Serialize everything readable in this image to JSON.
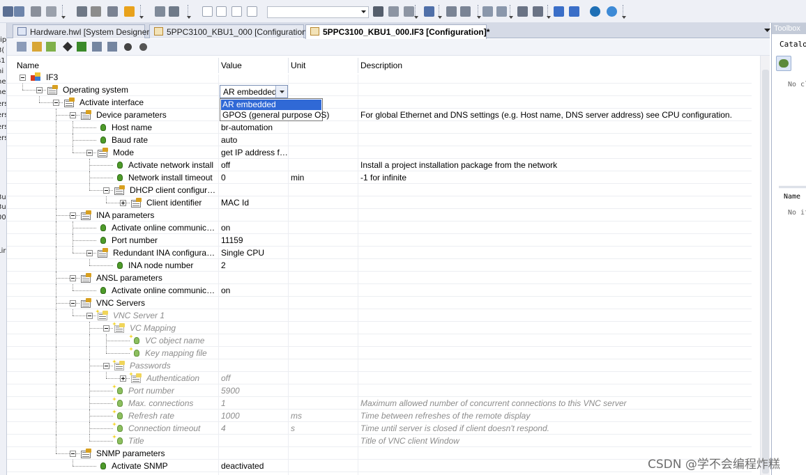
{
  "toolbar": {
    "icons": [
      "properties-icon",
      "grid-icon",
      "cut-icon",
      "paste-icon",
      "search-icon",
      "refresh-icon",
      "power-icon",
      "stop-icon",
      "gear-icon",
      "gear-settings-icon",
      "window-icon",
      "window-new-icon",
      "window-bubble-icon",
      "window-compare-icon",
      "binoculars-icon",
      "binoculars-back-icon",
      "binoculars-forward-icon",
      "save-icon",
      "sort-down-icon",
      "sort-up-icon",
      "arrow-up-icon",
      "arrow-down-icon",
      "list-icon",
      "list-indent-icon",
      "upload-icon",
      "minus-icon",
      "globe-icon",
      "help-icon"
    ],
    "combo_value": ""
  },
  "left_strip": {
    "fragments": [
      "rip",
      "3(",
      "s1",
      "hi",
      "he",
      "he",
      "ers",
      "ers",
      "ers",
      "ers",
      "3u",
      "3u",
      "00",
      "Lir"
    ]
  },
  "tabs": [
    {
      "label": "Hardware.hwl [System Designer]",
      "active": false,
      "icon": "hardware-icon"
    },
    {
      "label": "5PPC3100_KBU1_000 [Configuration]",
      "active": false,
      "icon": "configuration-icon"
    },
    {
      "label": "5PPC3100_KBU1_000.IF3 [Configuration]*",
      "active": true,
      "icon": "configuration-icon"
    }
  ],
  "editor_toolbar": {
    "icons": [
      "properties-icon",
      "grid-edit-icon",
      "bulb-icon",
      "diamond-icon",
      "diamond-pair-icon",
      "sort-down-icon",
      "sort-up-icon",
      "record-icon",
      "settings-icon"
    ]
  },
  "grid": {
    "columns": {
      "name": "Name",
      "value": "Value",
      "unit": "Unit",
      "description": "Description"
    },
    "rows": [
      {
        "name": "IF3",
        "value": "",
        "unit": "",
        "desc": "",
        "level": 0,
        "kind": "root",
        "exp": "minus",
        "dis": false
      },
      {
        "name": "Operating system",
        "value": "",
        "unit": "",
        "desc": "",
        "level": 1,
        "kind": "folder",
        "exp": "minus",
        "dis": false
      },
      {
        "name": "Activate interface",
        "value": "",
        "unit": "",
        "desc": "",
        "level": 2,
        "kind": "folder",
        "exp": "minus",
        "dis": false
      },
      {
        "name": "Device parameters",
        "value": "",
        "unit": "",
        "desc": "For global Ethernet and DNS settings (e.g. Host name, DNS server address) see CPU configuration.",
        "level": 3,
        "kind": "folder",
        "exp": "minus",
        "dis": false
      },
      {
        "name": "Host name",
        "value": "br-automation",
        "unit": "",
        "desc": "",
        "level": 4,
        "kind": "leaf",
        "exp": "",
        "dis": false
      },
      {
        "name": "Baud rate",
        "value": "auto",
        "unit": "",
        "desc": "",
        "level": 4,
        "kind": "leaf",
        "exp": "",
        "dis": false
      },
      {
        "name": "Mode",
        "value": "get IP address fro...",
        "unit": "",
        "desc": "",
        "level": 4,
        "kind": "folder",
        "exp": "minus",
        "dis": false
      },
      {
        "name": "Activate network install",
        "value": "off",
        "unit": "",
        "desc": "Install a project installation package from the network",
        "level": 5,
        "kind": "leaf",
        "exp": "",
        "dis": false
      },
      {
        "name": "Network install timeout",
        "value": "0",
        "unit": "min",
        "desc": "-1 for infinite",
        "level": 5,
        "kind": "leaf",
        "exp": "",
        "dis": false
      },
      {
        "name": "DHCP client configurat...",
        "value": "",
        "unit": "",
        "desc": "",
        "level": 5,
        "kind": "folder",
        "exp": "minus",
        "dis": false
      },
      {
        "name": "Client identifier",
        "value": "MAC Id",
        "unit": "",
        "desc": "",
        "level": 6,
        "kind": "folder",
        "exp": "plus",
        "dis": false
      },
      {
        "name": "INA parameters",
        "value": "",
        "unit": "",
        "desc": "",
        "level": 3,
        "kind": "folder",
        "exp": "minus",
        "dis": false
      },
      {
        "name": "Activate online communicati...",
        "value": "on",
        "unit": "",
        "desc": "",
        "level": 4,
        "kind": "leaf",
        "exp": "",
        "dis": false
      },
      {
        "name": "Port number",
        "value": "11159",
        "unit": "",
        "desc": "",
        "level": 4,
        "kind": "leaf",
        "exp": "",
        "dis": false
      },
      {
        "name": "Redundant INA configuration",
        "value": "Single CPU",
        "unit": "",
        "desc": "",
        "level": 4,
        "kind": "folder",
        "exp": "minus",
        "dis": false
      },
      {
        "name": "INA node number",
        "value": "2",
        "unit": "",
        "desc": "",
        "level": 5,
        "kind": "leaf",
        "exp": "",
        "dis": false
      },
      {
        "name": "ANSL parameters",
        "value": "",
        "unit": "",
        "desc": "",
        "level": 3,
        "kind": "folder",
        "exp": "minus",
        "dis": false
      },
      {
        "name": "Activate online communicati...",
        "value": "on",
        "unit": "",
        "desc": "",
        "level": 4,
        "kind": "leaf",
        "exp": "",
        "dis": false
      },
      {
        "name": "VNC Servers",
        "value": "",
        "unit": "",
        "desc": "",
        "level": 3,
        "kind": "folder",
        "exp": "minus",
        "dis": false
      },
      {
        "name": "VNC Server 1",
        "value": "",
        "unit": "",
        "desc": "",
        "level": 4,
        "kind": "folder",
        "exp": "minus",
        "dis": true
      },
      {
        "name": "VC Mapping",
        "value": "",
        "unit": "",
        "desc": "",
        "level": 5,
        "kind": "folder",
        "exp": "minus",
        "dis": true
      },
      {
        "name": "VC object name",
        "value": "",
        "unit": "",
        "desc": "",
        "level": 6,
        "kind": "leaf",
        "exp": "",
        "dis": true
      },
      {
        "name": "Key mapping file",
        "value": "",
        "unit": "",
        "desc": "",
        "level": 6,
        "kind": "leaf",
        "exp": "",
        "dis": true
      },
      {
        "name": "Passwords",
        "value": "",
        "unit": "",
        "desc": "",
        "level": 5,
        "kind": "folder",
        "exp": "minus",
        "dis": true
      },
      {
        "name": "Authentication",
        "value": "off",
        "unit": "",
        "desc": "",
        "level": 6,
        "kind": "folder",
        "exp": "plus",
        "dis": true
      },
      {
        "name": "Port number",
        "value": "5900",
        "unit": "",
        "desc": "",
        "level": 5,
        "kind": "leaf",
        "exp": "",
        "dis": true
      },
      {
        "name": "Max. connections",
        "value": "1",
        "unit": "",
        "desc": "Maximum allowed number of concurrent connections to this VNC server",
        "level": 5,
        "kind": "leaf",
        "exp": "",
        "dis": true
      },
      {
        "name": "Refresh rate",
        "value": "1000",
        "unit": "ms",
        "desc": "Time between refreshes of the remote display",
        "level": 5,
        "kind": "leaf",
        "exp": "",
        "dis": true
      },
      {
        "name": "Connection timeout",
        "value": "4",
        "unit": "s",
        "desc": "Time until server is closed if client doesn't respond.",
        "level": 5,
        "kind": "leaf",
        "exp": "",
        "dis": true
      },
      {
        "name": "Title",
        "value": "",
        "unit": "",
        "desc": "Title of VNC client Window",
        "level": 5,
        "kind": "leaf",
        "exp": "",
        "dis": true
      },
      {
        "name": "SNMP parameters",
        "value": "",
        "unit": "",
        "desc": "",
        "level": 3,
        "kind": "folder",
        "exp": "minus",
        "dis": false
      },
      {
        "name": "Activate SNMP",
        "value": "deactivated",
        "unit": "",
        "desc": "",
        "level": 4,
        "kind": "leaf",
        "exp": "",
        "dis": false
      }
    ]
  },
  "dropdown": {
    "current": "AR embedded",
    "options": [
      "AR embedded",
      "GPOS (general purpose OS)"
    ],
    "selected_index": 0
  },
  "toolbox": {
    "title": "Toolbox",
    "catalog_label": "Catalog",
    "no_catalog_text": "No cl",
    "name_header": "Name",
    "no_items_text": "No it"
  },
  "watermark": "CSDN @学不会编程炸糕",
  "colors": {
    "selection": "#3069d6",
    "disabled_text": "#8c8c8c",
    "folder_icon": "#d8a020",
    "leaf_icon": "#4e9b2a"
  }
}
